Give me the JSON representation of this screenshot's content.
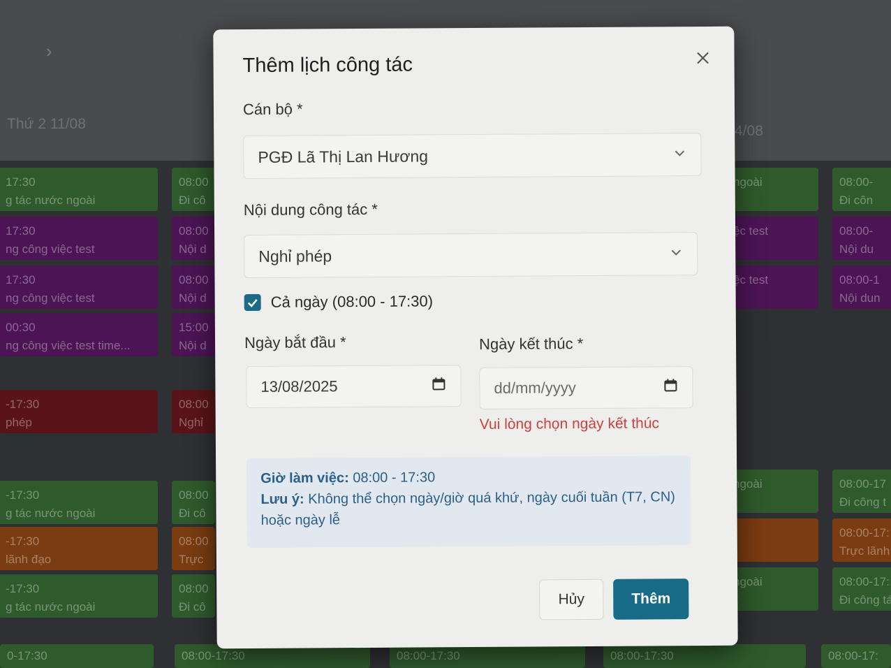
{
  "background": {
    "day_labels": [
      "Thứ 2 11/08",
      "4/08"
    ],
    "columns": [
      {
        "events": [
          {
            "time": "17:30",
            "text": "g tác nước ngoài",
            "color": "green"
          },
          {
            "time": "17:30",
            "text": "ng công việc test",
            "color": "purple"
          },
          {
            "time": "17:30",
            "text": "ng công việc test",
            "color": "purple"
          },
          {
            "time": "00:30",
            "text": "ng công việc test time...",
            "color": "purple"
          },
          {
            "time": "-17:30",
            "text": "phép",
            "color": "red"
          },
          {
            "time": "-17:30",
            "text": "g tác nước ngoài",
            "color": "green"
          },
          {
            "time": "-17:30",
            "text": "lãnh đạo",
            "color": "orange"
          },
          {
            "time": "-17:30",
            "text": "g tác nước ngoài",
            "color": "green"
          },
          {
            "time": "0-17:30",
            "text": "",
            "color": "green"
          }
        ]
      },
      {
        "events": [
          {
            "time": "08:00",
            "text": "Đi cô",
            "color": "green"
          },
          {
            "time": "08:00",
            "text": "Nội d",
            "color": "purple"
          },
          {
            "time": "08:00",
            "text": "Nội d",
            "color": "purple"
          },
          {
            "time": "15:00",
            "text": "Nội d",
            "color": "purple"
          },
          {
            "time": "08:00",
            "text": "Nghỉ",
            "color": "red"
          },
          {
            "time": "08:00",
            "text": "Đi cô",
            "color": "green"
          },
          {
            "time": "08:00",
            "text": "Trực",
            "color": "orange"
          },
          {
            "time": "08:00",
            "text": "Đi cô",
            "color": "green"
          },
          {
            "time": "08:00-17:30",
            "text": "",
            "color": "green"
          }
        ]
      },
      {
        "events": [
          {
            "time": "",
            "text": "ngoài",
            "color": "green"
          },
          {
            "time": "",
            "text": "ệc test",
            "color": "purple"
          },
          {
            "time": "",
            "text": "ệc test",
            "color": "purple"
          },
          {
            "time": "",
            "text": "ngoài",
            "color": "green"
          },
          {
            "time": "",
            "text": "",
            "color": "orange"
          },
          {
            "time": "",
            "text": "ngoài",
            "color": "green"
          }
        ]
      },
      {
        "events": [
          {
            "time": "08:00-",
            "text": "Đi côn",
            "color": "green"
          },
          {
            "time": "08:00-",
            "text": "Nội du",
            "color": "purple"
          },
          {
            "time": "08:00-1",
            "text": "Nội dun",
            "color": "purple"
          },
          {
            "time": "08:00-17",
            "text": "Đi công t",
            "color": "green"
          },
          {
            "time": "08:00-17:",
            "text": "Trực lãnh",
            "color": "orange"
          },
          {
            "time": "08:00-17:",
            "text": "Đi công tá",
            "color": "green"
          }
        ]
      }
    ],
    "bottom_times": [
      "08:00-17:30",
      "08:00-17:30",
      "08:00-17:30",
      "08:00-17:"
    ]
  },
  "modal": {
    "title": "Thêm lịch công tác",
    "officer_label": "Cán bộ *",
    "officer_value": "PGĐ Lã Thị Lan Hương",
    "content_label": "Nội dung công tác *",
    "content_value": "Nghỉ phép",
    "all_day_label": "Cả ngày (08:00 - 17:30)",
    "all_day_checked": true,
    "start_label": "Ngày bắt đầu *",
    "start_value": "13/08/2025",
    "end_label": "Ngày kết thúc *",
    "end_placeholder": "dd/mm/yyyy",
    "end_error": "Vui lòng chọn ngày kết thúc",
    "info": {
      "hours_label": "Giờ làm việc:",
      "hours_value": "08:00 - 17:30",
      "note_label": "Lưu ý:",
      "note_text": "Không thể chọn ngày/giờ quá khứ, ngày cuối tuần (T7, CN) hoặc ngày lễ"
    },
    "cancel_label": "Hủy",
    "submit_label": "Thêm"
  },
  "colors": {
    "primary": "#176b86",
    "error": "#d0403f",
    "info_text": "#2a5f8a",
    "info_bg": "#e2e8ef",
    "event_green": "#2f5a2c",
    "event_purple": "#4c1455",
    "event_red": "#5a1419",
    "event_orange": "#7a3c10"
  }
}
